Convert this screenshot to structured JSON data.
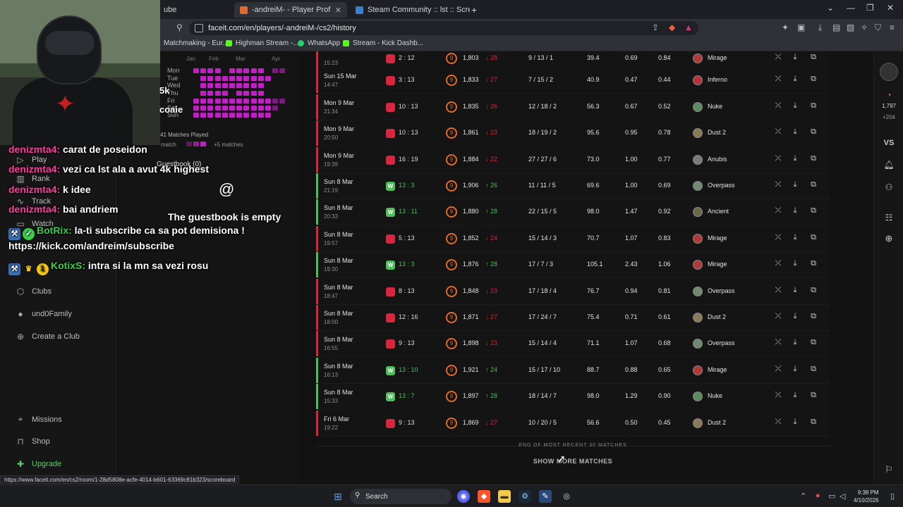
{
  "browser": {
    "tabs": [
      {
        "label": "ube",
        "active": false
      },
      {
        "label": "-andreiM- - Player Profile - FACE",
        "active": true
      },
      {
        "label": "Steam Community :: lst :: Screenshots",
        "active": false
      }
    ],
    "new_tab": "+",
    "url": "faceit.com/en/players/-andreiM-/cs2/history",
    "bookmarks": [
      "Matchmaking - Eur...",
      "Highman Stream -...",
      "WhatsApp",
      "Stream - Kick Dashb..."
    ]
  },
  "sidebar": {
    "items": [
      "Play",
      "Rank",
      "Track",
      "Watch",
      "Clubs",
      "und0Family",
      "Create a Club"
    ],
    "bottom": [
      "Missions",
      "Shop",
      "Upgrade"
    ]
  },
  "profile": {
    "heat_days": [
      "Sun",
      "Mon",
      "Tue",
      "Wed",
      "Thu",
      "Fri",
      "Sat",
      "Sun"
    ],
    "heat_cols": [
      "Jan",
      "Feb",
      "Mar",
      "Apr"
    ],
    "matches_played": "41 Matches Played",
    "legend": [
      "match",
      "+5 matches"
    ],
    "overlay_5k": "5k",
    "overlay_coaie": "coaie"
  },
  "matches": [
    {
      "date": "",
      "time": "15:23",
      "result": "L",
      "score": "2 : 12",
      "elo": "1,803",
      "delta": "28",
      "kda": "9 / 13 / 1",
      "adr": "39.4",
      "kd": "0.69",
      "kr": "0.84",
      "map": "Mirage"
    },
    {
      "date": "Sun 15 Mar",
      "time": "14:47",
      "result": "L",
      "score": "3 : 13",
      "elo": "1,833",
      "delta": "27",
      "kda": "7 / 15 / 2",
      "adr": "40.9",
      "kd": "0.47",
      "kr": "0.44",
      "map": "Inferno"
    },
    {
      "date": "Mon 9 Mar",
      "time": "21:34",
      "result": "L",
      "score": "10 : 13",
      "elo": "1,835",
      "delta": "26",
      "kda": "12 / 18 / 2",
      "adr": "56.3",
      "kd": "0.67",
      "kr": "0.52",
      "map": "Nuke"
    },
    {
      "date": "Mon 9 Mar",
      "time": "20:50",
      "result": "L",
      "score": "10 : 13",
      "elo": "1,861",
      "delta": "23",
      "kda": "18 / 19 / 2",
      "adr": "95.6",
      "kd": "0.95",
      "kr": "0.78",
      "map": "Dust 2"
    },
    {
      "date": "Mon 9 Mar",
      "time": "19:39",
      "result": "L",
      "score": "16 : 19",
      "elo": "1,884",
      "delta": "22",
      "kda": "27 / 27 / 6",
      "adr": "73.0",
      "kd": "1.00",
      "kr": "0.77",
      "map": "Anubis"
    },
    {
      "date": "Sun 8 Mar",
      "time": "21:19",
      "result": "W",
      "score": "13 : 3",
      "elo": "1,906",
      "delta": "26",
      "kda": "11 / 11 / 5",
      "adr": "69.6",
      "kd": "1.00",
      "kr": "0.69",
      "map": "Overpass"
    },
    {
      "date": "Sun 8 Mar",
      "time": "20:33",
      "result": "W",
      "score": "13 : 11",
      "elo": "1,880",
      "delta": "28",
      "kda": "22 / 15 / 5",
      "adr": "98.0",
      "kd": "1.47",
      "kr": "0.92",
      "map": "Ancient"
    },
    {
      "date": "Sun 8 Mar",
      "time": "19:57",
      "result": "L",
      "score": "5 : 13",
      "elo": "1,852",
      "delta": "24",
      "kda": "15 / 14 / 3",
      "adr": "70.7",
      "kd": "1.07",
      "kr": "0.83",
      "map": "Mirage"
    },
    {
      "date": "Sun 8 Mar",
      "time": "19:30",
      "result": "W",
      "score": "13 : 3",
      "elo": "1,876",
      "delta": "28",
      "kda": "17 / 7 / 3",
      "adr": "105.1",
      "kd": "2.43",
      "kr": "1.06",
      "map": "Mirage"
    },
    {
      "date": "Sun 8 Mar",
      "time": "18:47",
      "result": "L",
      "score": "8 : 13",
      "elo": "1,848",
      "delta": "23",
      "kda": "17 / 18 / 4",
      "adr": "76.7",
      "kd": "0.94",
      "kr": "0.81",
      "map": "Overpass"
    },
    {
      "date": "Sun 8 Mar",
      "time": "18:00",
      "result": "L",
      "score": "12 : 16",
      "elo": "1,871",
      "delta": "27",
      "kda": "17 / 24 / 7",
      "adr": "75.4",
      "kd": "0.71",
      "kr": "0.61",
      "map": "Dust 2"
    },
    {
      "date": "Sun 8 Mar",
      "time": "16:55",
      "result": "L",
      "score": "9 : 13",
      "elo": "1,898",
      "delta": "23",
      "kda": "15 / 14 / 4",
      "adr": "71.1",
      "kd": "1.07",
      "kr": "0.68",
      "map": "Overpass"
    },
    {
      "date": "Sun 8 Mar",
      "time": "16:13",
      "result": "W",
      "score": "13 : 10",
      "elo": "1,921",
      "delta": "24",
      "kda": "15 / 17 / 10",
      "adr": "88.7",
      "kd": "0.88",
      "kr": "0.65",
      "map": "Mirage"
    },
    {
      "date": "Sun 8 Mar",
      "time": "15:33",
      "result": "W",
      "score": "13 : 7",
      "elo": "1,897",
      "delta": "28",
      "kda": "18 / 14 / 7",
      "adr": "98.0",
      "kd": "1.29",
      "kr": "0.90",
      "map": "Nuke"
    },
    {
      "date": "Fri 6 Mar",
      "time": "19:22",
      "result": "L",
      "score": "9 : 13",
      "elo": "1,869",
      "delta": "27",
      "kda": "10 / 20 / 5",
      "adr": "56.6",
      "kd": "0.50",
      "kr": "0.45",
      "map": "Dust 2"
    }
  ],
  "end_note": "END OF MOST RECENT 30 MATCHES",
  "show_more": "SHOW MORE MATCHES",
  "rail": {
    "elo": "1,797",
    "elo_delta": "+204",
    "vs": "VS",
    "friends_badge": "3"
  },
  "status_url": "https://www.faceit.com/en/cs2/room/1-28d5808e-acfe-4014-b601-63369c81b323/scoreboard",
  "stream": {
    "chat": [
      {
        "user": "denizmta4:",
        "msg": "carat de poseidon"
      },
      {
        "user": "denizmta4:",
        "msg": "vezi ca lst ala a avut 4k highest"
      },
      {
        "user": "denizmta4:",
        "msg": "k idee"
      },
      {
        "user": "denizmta4:",
        "msg": "bai andriem"
      },
      {
        "user": "BotRix:",
        "msg": "la-ti subscribe ca sa pot demisiona !"
      },
      {
        "user": "",
        "msg": "https://kick.com/andreim/subscribe"
      },
      {
        "user": "KotixS:",
        "msg": "intra si la mn sa vezi rosu"
      }
    ],
    "guestbook_title": "Guestbook (0)",
    "guestbook_empty": "The guestbook is empty",
    "at": "@"
  },
  "taskbar": {
    "search": "Search",
    "time": "9:38 PM",
    "date": "4/10/2026"
  },
  "colors": {
    "win": "#4cbe5a",
    "loss": "#d7263d",
    "accent": "#e26a2c",
    "heat": "#c21fc6"
  }
}
